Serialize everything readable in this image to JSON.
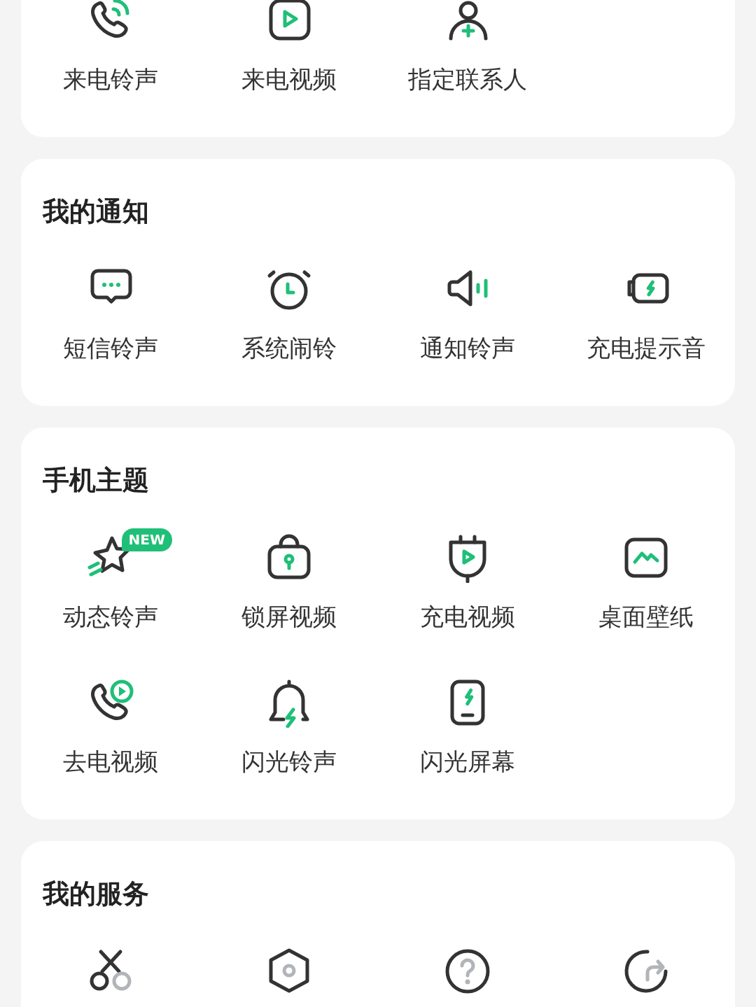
{
  "sections": [
    {
      "items": [
        {
          "kind": "tile",
          "label": "来电铃声"
        },
        {
          "kind": "tile",
          "label": "来电视频"
        },
        {
          "kind": "tile",
          "label": "指定联系人"
        }
      ]
    },
    {
      "title": "我的通知",
      "items": [
        {
          "kind": "tile",
          "label": "短信铃声"
        },
        {
          "kind": "tile",
          "label": "系统闹铃"
        },
        {
          "kind": "tile",
          "label": "通知铃声"
        },
        {
          "kind": "tile",
          "label": "充电提示音"
        }
      ]
    },
    {
      "title": "手机主题",
      "items": [
        {
          "kind": "tile",
          "label": "动态铃声",
          "badge": "NEW"
        },
        {
          "kind": "tile",
          "label": "锁屏视频"
        },
        {
          "kind": "tile",
          "label": "充电视频"
        },
        {
          "kind": "tile",
          "label": "桌面壁纸"
        },
        {
          "kind": "tile",
          "label": "去电视频"
        },
        {
          "kind": "tile",
          "label": "闪光铃声"
        },
        {
          "kind": "tile",
          "label": "闪光屏幕"
        }
      ]
    },
    {
      "title": "我的服务",
      "items": [
        {
          "kind": "tile"
        },
        {
          "kind": "tile"
        },
        {
          "kind": "tile"
        },
        {
          "kind": "tile"
        }
      ]
    }
  ]
}
